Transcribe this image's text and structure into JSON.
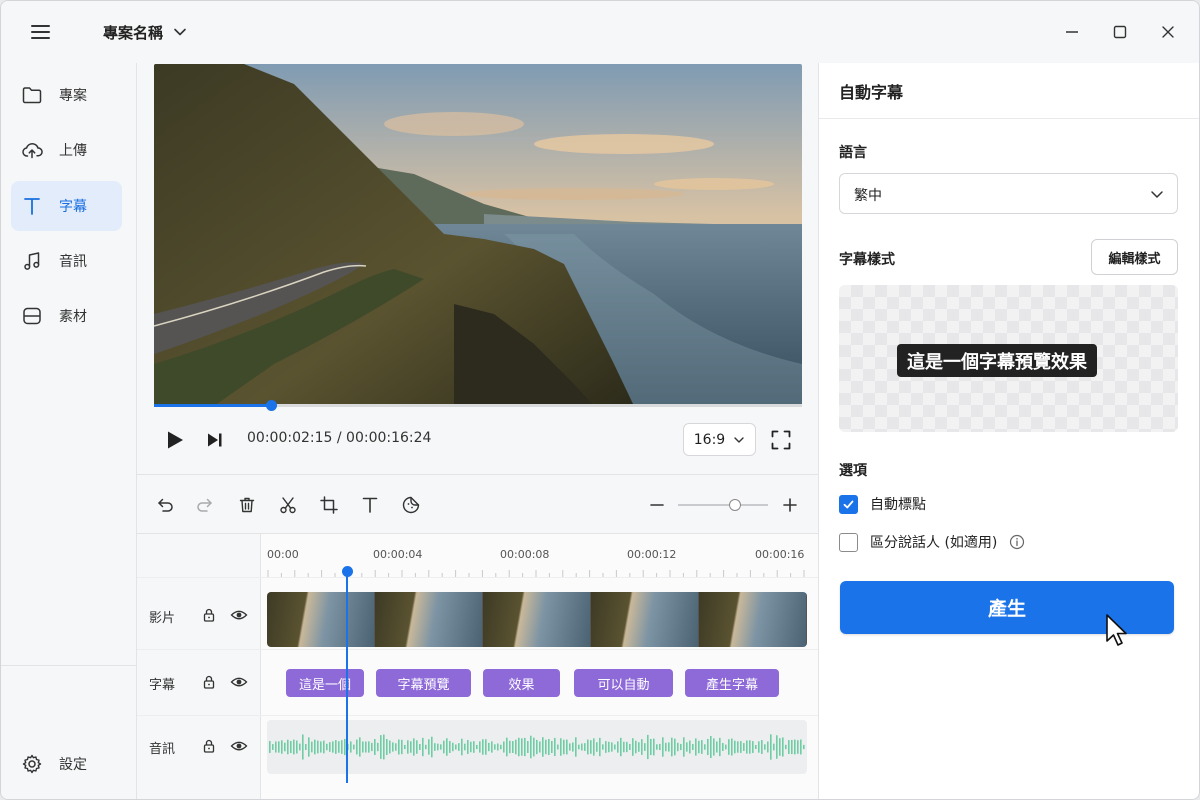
{
  "titlebar": {
    "project_name": "專案名稱",
    "icons": {
      "menu": "hamburger-menu-icon",
      "dropdown": "chevron-down-icon",
      "minimize": "minimize-icon",
      "maximize": "maximize-icon",
      "close": "close-icon"
    }
  },
  "sidebar": {
    "items": [
      {
        "label": "專案",
        "icon": "folder-icon",
        "active": false
      },
      {
        "label": "上傳",
        "icon": "cloud-upload-icon",
        "active": false
      },
      {
        "label": "字幕",
        "icon": "text-icon",
        "active": true
      },
      {
        "label": "音訊",
        "icon": "music-note-icon",
        "active": false
      },
      {
        "label": "素材",
        "icon": "asset-library-icon",
        "active": false
      }
    ],
    "settings_label": "設定"
  },
  "player": {
    "current_time": "00:00:02:15",
    "separator": " / ",
    "total_time": "00:00:16:24",
    "progress": 0.18,
    "aspect_ratio": "16:9"
  },
  "toolbar": {
    "tools": [
      "undo-icon",
      "redo-icon",
      "delete-icon",
      "cut-icon",
      "crop-icon",
      "text-icon",
      "sticker-icon"
    ],
    "zoom_level": 0.63
  },
  "timeline": {
    "ruler": [
      "00:00",
      "00:00:04",
      "00:00:08",
      "00:00:12",
      "00:00:16"
    ],
    "playhead_position": 0.148,
    "tracks": [
      {
        "name": "影片",
        "locked": false,
        "visible": true
      },
      {
        "name": "字幕",
        "locked": false,
        "visible": true
      },
      {
        "name": "音訊",
        "locked": false,
        "visible": true
      }
    ],
    "subtitle_clips": [
      "這是一個",
      "字幕預覽",
      "效果",
      "可以自動",
      "產生字幕"
    ],
    "waveform_color": "#6fcca3",
    "clip_color": "#8e6ad8"
  },
  "panel": {
    "title": "自動字幕",
    "language_label": "語言",
    "language_value": "繁中",
    "style_label": "字幕樣式",
    "edit_style_label": "編輯樣式",
    "sample_caption": "這是一個字幕預覽效果",
    "options_label": "選項",
    "options": [
      {
        "label": "自動標點",
        "checked": true
      },
      {
        "label": "區分說話人 (如適用)",
        "checked": false,
        "has_info": true
      }
    ],
    "generate_label": "產生"
  },
  "colors": {
    "accent": "#1a73e8",
    "active_bg": "#e3ecfb"
  }
}
